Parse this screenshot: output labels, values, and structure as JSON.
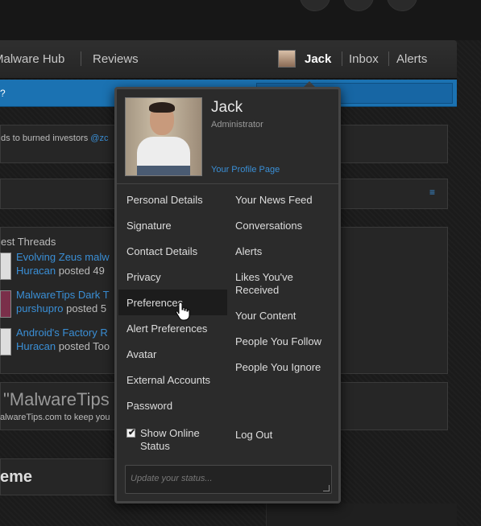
{
  "nav": {
    "items": [
      "Malware Hub",
      "Reviews"
    ],
    "user_name": "Jack",
    "inbox": "Inbox",
    "alerts": "Alerts"
  },
  "notice": {
    "text": "?"
  },
  "background": {
    "tweet_text": "ds to burned investors",
    "tweet_mention": "@zc",
    "latest_threads_label": "est Threads",
    "threads": [
      {
        "title": "Evolving Zeus malw",
        "author": "Huracan",
        "meta": "posted 49"
      },
      {
        "title": "MalwareTips Dark T",
        "author": "purshupro",
        "meta": "posted 5"
      },
      {
        "title": "Android's Factory R",
        "author": "Huracan",
        "meta": "posted Too"
      }
    ],
    "quote_title": "\"MalwareTips",
    "quote_text": "alwareTips.com to keep you",
    "scheme_title": "eme"
  },
  "popup": {
    "name": "Jack",
    "role": "Administrator",
    "profile_link": "Your Profile Page",
    "left_menu": [
      "Personal Details",
      "Signature",
      "Contact Details",
      "Privacy",
      "Preferences",
      "Alert Preferences",
      "Avatar",
      "External Accounts",
      "Password"
    ],
    "right_menu": [
      "Your News Feed",
      "Conversations",
      "Alerts",
      "Likes You've Received",
      "Your Content",
      "People You Follow",
      "People You Ignore"
    ],
    "highlighted_item": "Preferences",
    "show_online_status": {
      "label": "Show Online Status",
      "checked": true
    },
    "logout": "Log Out",
    "status_placeholder": "Update your status..."
  },
  "colors": {
    "accent": "#1b72b2",
    "link": "#3a8fd6",
    "popup_bg": "#2b2b2b"
  }
}
